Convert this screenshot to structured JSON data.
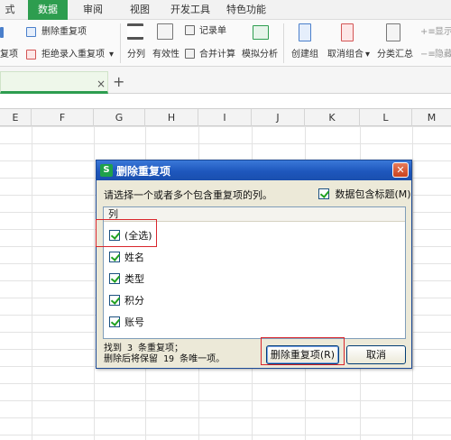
{
  "ribbon_tabs": [
    {
      "label": "式",
      "active": false
    },
    {
      "label": "数据",
      "active": true
    },
    {
      "label": "审阅",
      "active": false
    },
    {
      "label": "视图",
      "active": false
    },
    {
      "label": "开发工具",
      "active": false
    },
    {
      "label": "特色功能",
      "active": false
    }
  ],
  "ribbon": {
    "remove_duplicates": "删除重复项",
    "dup_fragment": "复项",
    "reject_duplicates": "拒绝录入重复项",
    "split": "分列",
    "validity": "有效性",
    "record_sheet": "记录单",
    "merge_calc": "合并计算",
    "simulate": "模拟分析",
    "create_group": "创建组",
    "ungroup": "取消组合",
    "subtotal": "分类汇总",
    "show_fragment": "显示",
    "hide_fragment": "隐藏"
  },
  "doc_tab": {
    "close": "×",
    "new_tab": "+"
  },
  "columns": [
    "E",
    "F",
    "G",
    "H",
    "I",
    "J",
    "K",
    "L",
    "M"
  ],
  "dialog": {
    "icon_letter": "S",
    "title": "删除重复项",
    "close": "✕",
    "prompt": "请选择一个或者多个包含重复项的列。",
    "header_checkbox_label": "数据包含标题(M)",
    "list_header": "列",
    "items": [
      "(全选)",
      "姓名",
      "类型",
      "积分",
      "账号"
    ],
    "status_line1": "找到 3 条重复项；",
    "status_line2": "删除后将保留 19 条唯一项。",
    "primary_button": "删除重复项(R)",
    "cancel_button": "取消"
  },
  "colors": {
    "accent": "#2d9d4f",
    "highlight": "#d9262c",
    "titlebar": "#1e57bd"
  }
}
